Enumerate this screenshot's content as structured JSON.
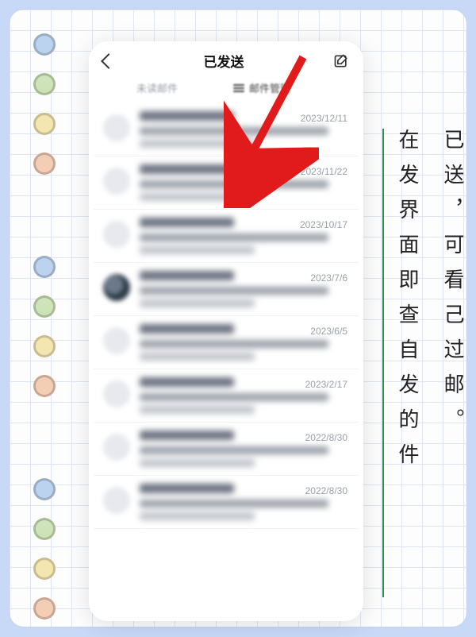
{
  "decor": {
    "dot_colors_top": [
      "#bcd3ef",
      "#cfe3b9",
      "#f4e6b0",
      "#f4cdb5"
    ],
    "dot_colors_mid": [
      "#bcd3ef",
      "#cfe3b9",
      "#f4e6b0",
      "#f4cdb5"
    ],
    "dot_colors_bot": [
      "#bcd3ef",
      "#cfe3b9",
      "#f4e6b0",
      "#f4cdb5"
    ]
  },
  "phone": {
    "title": "已发送",
    "back_icon": "chevron-left",
    "compose_icon": "compose",
    "sub_left": "未读邮件",
    "sub_right": "邮件管理",
    "rows": [
      {
        "date": "2023/12/11",
        "avatar": "plain"
      },
      {
        "date": "2023/11/22",
        "avatar": "plain"
      },
      {
        "date": "2023/10/17",
        "avatar": "plain"
      },
      {
        "date": "2023/7/6",
        "avatar": "photo"
      },
      {
        "date": "2023/6/5",
        "avatar": "plain"
      },
      {
        "date": "2023/2/17",
        "avatar": "plain"
      },
      {
        "date": "2022/8/30",
        "avatar": "plain"
      },
      {
        "date": "2022/8/30",
        "avatar": "plain"
      }
    ]
  },
  "annotation": {
    "col1": "在发界面即查自发的件",
    "col2": "已送，可看己过邮。"
  },
  "arrow_color": "#e11b1b"
}
